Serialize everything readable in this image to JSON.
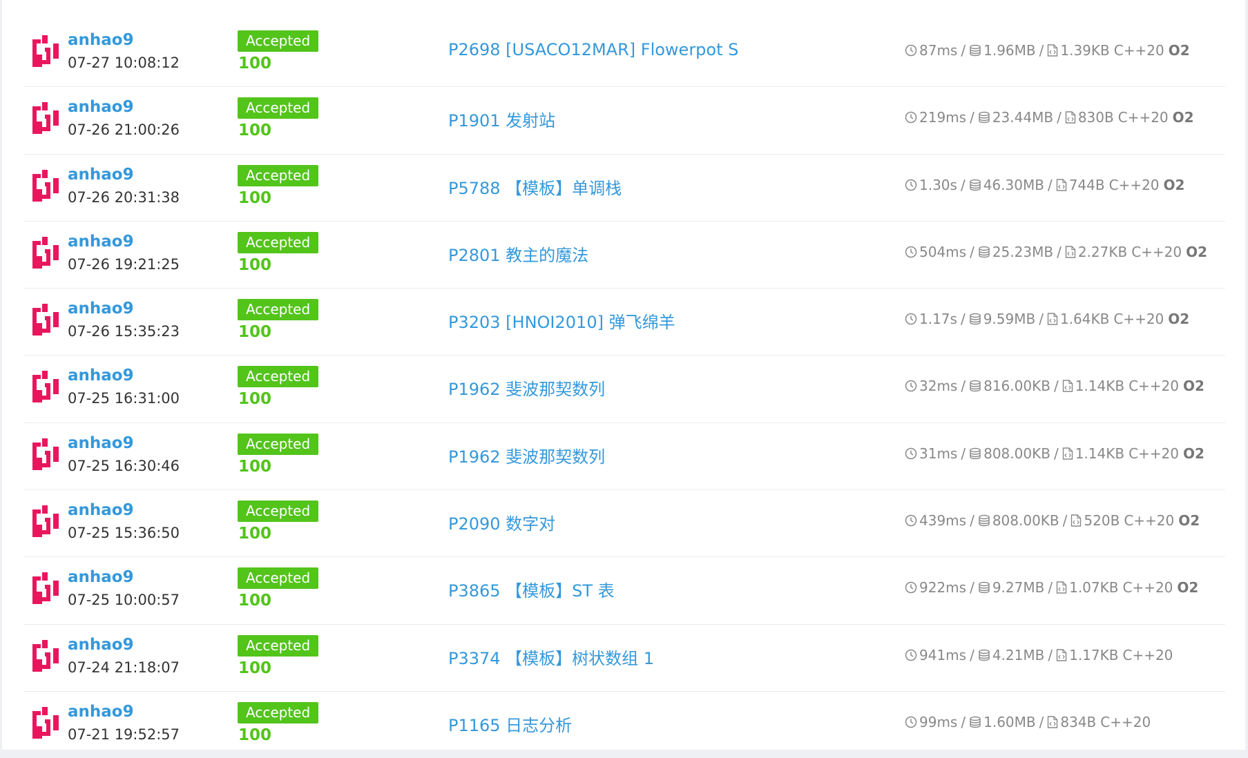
{
  "colors": {
    "link": "#3498db",
    "accepted_bg": "#52c41a",
    "score": "#52c41a",
    "meta": "#888888",
    "avatar": "#e8175d"
  },
  "icons": {
    "avatar": "user-avatar-logo",
    "time": "clock-icon",
    "memory": "database-icon",
    "code": "code-file-icon"
  },
  "records": [
    {
      "user": "anhao9",
      "time": "07-27 10:08:12",
      "status": "Accepted",
      "score": "100",
      "problem": "P2698 [USACO12MAR] Flowerpot S",
      "runtime": "87ms",
      "memory": "1.96MB",
      "code_size": "1.39KB",
      "lang": "C++20",
      "o2": "O2"
    },
    {
      "user": "anhao9",
      "time": "07-26 21:00:26",
      "status": "Accepted",
      "score": "100",
      "problem": "P1901 发射站",
      "runtime": "219ms",
      "memory": "23.44MB",
      "code_size": "830B",
      "lang": "C++20",
      "o2": "O2"
    },
    {
      "user": "anhao9",
      "time": "07-26 20:31:38",
      "status": "Accepted",
      "score": "100",
      "problem": "P5788 【模板】单调栈",
      "runtime": "1.30s",
      "memory": "46.30MB",
      "code_size": "744B",
      "lang": "C++20",
      "o2": "O2"
    },
    {
      "user": "anhao9",
      "time": "07-26 19:21:25",
      "status": "Accepted",
      "score": "100",
      "problem": "P2801 教主的魔法",
      "runtime": "504ms",
      "memory": "25.23MB",
      "code_size": "2.27KB",
      "lang": "C++20",
      "o2": "O2"
    },
    {
      "user": "anhao9",
      "time": "07-26 15:35:23",
      "status": "Accepted",
      "score": "100",
      "problem": "P3203 [HNOI2010] 弹飞绵羊",
      "runtime": "1.17s",
      "memory": "9.59MB",
      "code_size": "1.64KB",
      "lang": "C++20",
      "o2": "O2"
    },
    {
      "user": "anhao9",
      "time": "07-25 16:31:00",
      "status": "Accepted",
      "score": "100",
      "problem": "P1962 斐波那契数列",
      "runtime": "32ms",
      "memory": "816.00KB",
      "code_size": "1.14KB",
      "lang": "C++20",
      "o2": "O2"
    },
    {
      "user": "anhao9",
      "time": "07-25 16:30:46",
      "status": "Accepted",
      "score": "100",
      "problem": "P1962 斐波那契数列",
      "runtime": "31ms",
      "memory": "808.00KB",
      "code_size": "1.14KB",
      "lang": "C++20",
      "o2": "O2"
    },
    {
      "user": "anhao9",
      "time": "07-25 15:36:50",
      "status": "Accepted",
      "score": "100",
      "problem": "P2090 数字对",
      "runtime": "439ms",
      "memory": "808.00KB",
      "code_size": "520B",
      "lang": "C++20",
      "o2": "O2"
    },
    {
      "user": "anhao9",
      "time": "07-25 10:00:57",
      "status": "Accepted",
      "score": "100",
      "problem": "P3865 【模板】ST 表",
      "runtime": "922ms",
      "memory": "9.27MB",
      "code_size": "1.07KB",
      "lang": "C++20",
      "o2": "O2"
    },
    {
      "user": "anhao9",
      "time": "07-24 21:18:07",
      "status": "Accepted",
      "score": "100",
      "problem": "P3374 【模板】树状数组 1",
      "runtime": "941ms",
      "memory": "4.21MB",
      "code_size": "1.17KB",
      "lang": "C++20",
      "o2": ""
    },
    {
      "user": "anhao9",
      "time": "07-21 19:52:57",
      "status": "Accepted",
      "score": "100",
      "problem": "P1165 日志分析",
      "runtime": "99ms",
      "memory": "1.60MB",
      "code_size": "834B",
      "lang": "C++20",
      "o2": ""
    }
  ]
}
